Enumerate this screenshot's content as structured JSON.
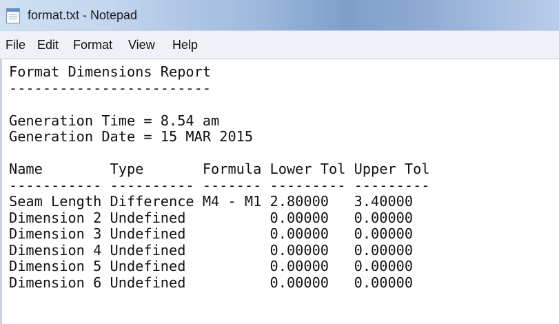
{
  "window": {
    "title": "format.txt - Notepad",
    "app_icon": "notepad-icon"
  },
  "menu": {
    "items": [
      "File",
      "Edit",
      "Format",
      "View",
      "Help"
    ]
  },
  "document": {
    "lines": [
      "Format Dimensions Report",
      "------------------------",
      "",
      "Generation Time = 8.54 am",
      "Generation Date = 15 MAR 2015",
      "",
      "Name        Type       Formula Lower Tol Upper Tol",
      "----------- ---------- ------- --------- ---------",
      "Seam Length Difference M4 - M1 2.80000   3.40000",
      "Dimension 2 Undefined          0.00000   0.00000",
      "Dimension 3 Undefined          0.00000   0.00000",
      "Dimension 4 Undefined          0.00000   0.00000",
      "Dimension 5 Undefined          0.00000   0.00000",
      "Dimension 6 Undefined          0.00000   0.00000"
    ]
  }
}
